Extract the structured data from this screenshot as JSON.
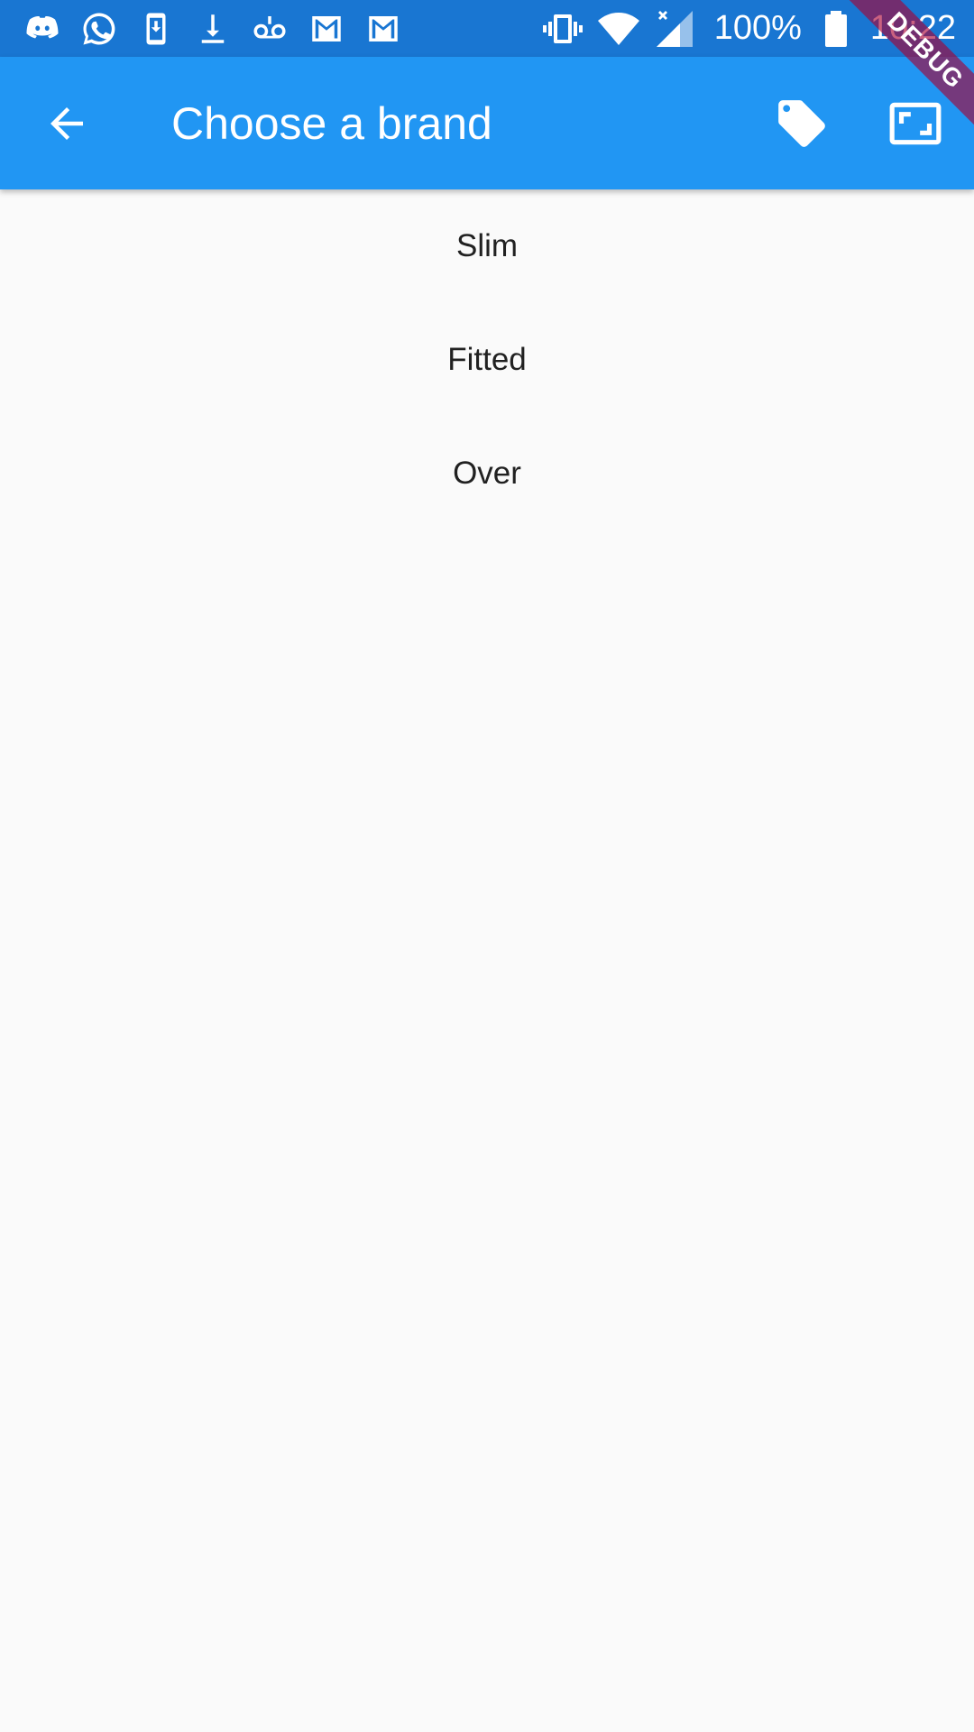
{
  "status_bar": {
    "notification_icons": [
      "discord-icon",
      "whatsapp-icon",
      "phone-download-icon",
      "download-icon",
      "voicemail-icon",
      "gmail-icon",
      "gmail-icon"
    ],
    "system_icons": [
      "vibrate-icon",
      "wifi-icon",
      "signal-icon",
      "battery-icon"
    ],
    "battery": "100%",
    "time": "10:22"
  },
  "app_bar": {
    "title": "Choose a brand",
    "actions": [
      "tag-icon",
      "aspect-ratio-icon"
    ]
  },
  "debug_banner": "DEBUG",
  "list": {
    "items": [
      "Slim",
      "Fitted",
      "Over"
    ]
  },
  "colors": {
    "status_bar": "#1976d2",
    "app_bar": "#2196f3",
    "background": "#fafafa",
    "text": "#212121"
  }
}
